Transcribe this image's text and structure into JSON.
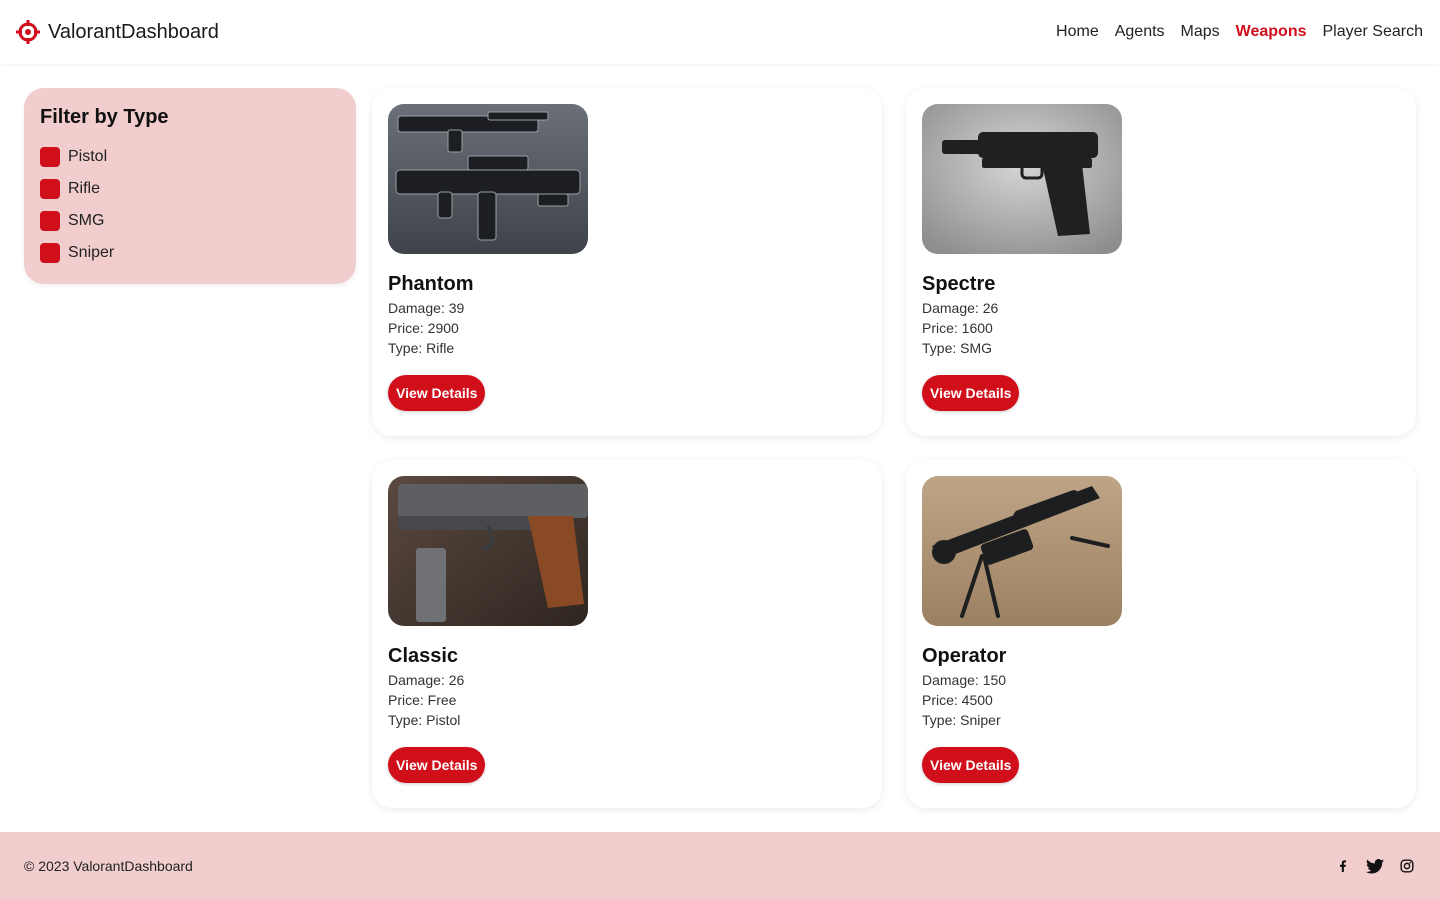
{
  "header": {
    "brand": "ValorantDashboard",
    "nav": [
      {
        "label": "Home",
        "active": false
      },
      {
        "label": "Agents",
        "active": false
      },
      {
        "label": "Maps",
        "active": false
      },
      {
        "label": "Weapons",
        "active": true
      },
      {
        "label": "Player Search",
        "active": false
      }
    ]
  },
  "sidebar": {
    "title": "Filter by Type",
    "filters": [
      {
        "label": "Pistol",
        "checked": true
      },
      {
        "label": "Rifle",
        "checked": true
      },
      {
        "label": "SMG",
        "checked": true
      },
      {
        "label": "Sniper",
        "checked": true
      }
    ]
  },
  "weapons": [
    {
      "name": "Phantom",
      "damage": "Damage: 39",
      "price": "Price: 2900",
      "type": "Type: Rifle",
      "button": "View Details"
    },
    {
      "name": "Spectre",
      "damage": "Damage: 26",
      "price": "Price: 1600",
      "type": "Type: SMG",
      "button": "View Details"
    },
    {
      "name": "Classic",
      "damage": "Damage: 26",
      "price": "Price: Free",
      "type": "Type: Pistol",
      "button": "View Details"
    },
    {
      "name": "Operator",
      "damage": "Damage: 150",
      "price": "Price: 4500",
      "type": "Type: Sniper",
      "button": "View Details"
    }
  ],
  "footer": {
    "copyright": "© 2023 ValorantDashboard",
    "socials": [
      "facebook-icon",
      "twitter-icon",
      "instagram-icon"
    ]
  },
  "colors": {
    "accent": "#d10f1b",
    "panel": "#f2cdcd"
  }
}
